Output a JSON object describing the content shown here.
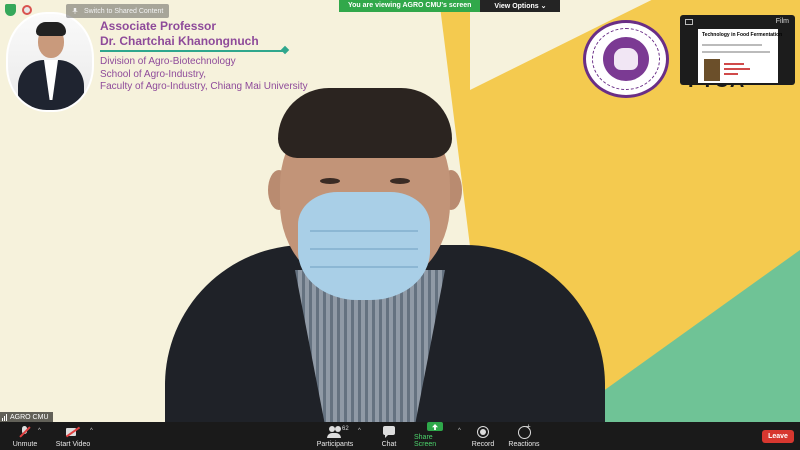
{
  "slide": {
    "title": "Associate Professor",
    "name": "Dr. Chartchai Khanongnuch",
    "affiliation": [
      "Division of Agro-Biotechnology",
      "School of Agro-Industry,",
      "Faculty of Agro-Industry, Chiang Mai University"
    ],
    "brand": "FTCA",
    "accent_purple": "#8e4a9a",
    "accent_teal": "#2fa78d"
  },
  "top_bar": {
    "switch_label": "Switch to Shared Content",
    "share_status": "You are viewing AGRO CMU's screen",
    "view_options_label": "View Options"
  },
  "filmstrip": {
    "label": "Film",
    "slide_title": "Technology in Food Fermentation"
  },
  "participant": {
    "name": "AGRO CMU"
  },
  "toolbar": {
    "unmute": "Unmute",
    "start_video": "Start Video",
    "participants": "Participants",
    "participants_count": "62",
    "chat": "Chat",
    "share_screen": "Share Screen",
    "record": "Record",
    "reactions": "Reactions",
    "leave": "Leave"
  },
  "colors": {
    "share_green": "#31a84a",
    "leave_red": "#d7372f",
    "toolbar_bg": "#1a1a1a"
  },
  "icons": [
    "shield-icon",
    "recording-icon",
    "pin-icon",
    "mic-muted-icon",
    "video-off-icon",
    "participants-icon",
    "chat-icon",
    "share-screen-icon",
    "record-icon",
    "reactions-icon"
  ]
}
